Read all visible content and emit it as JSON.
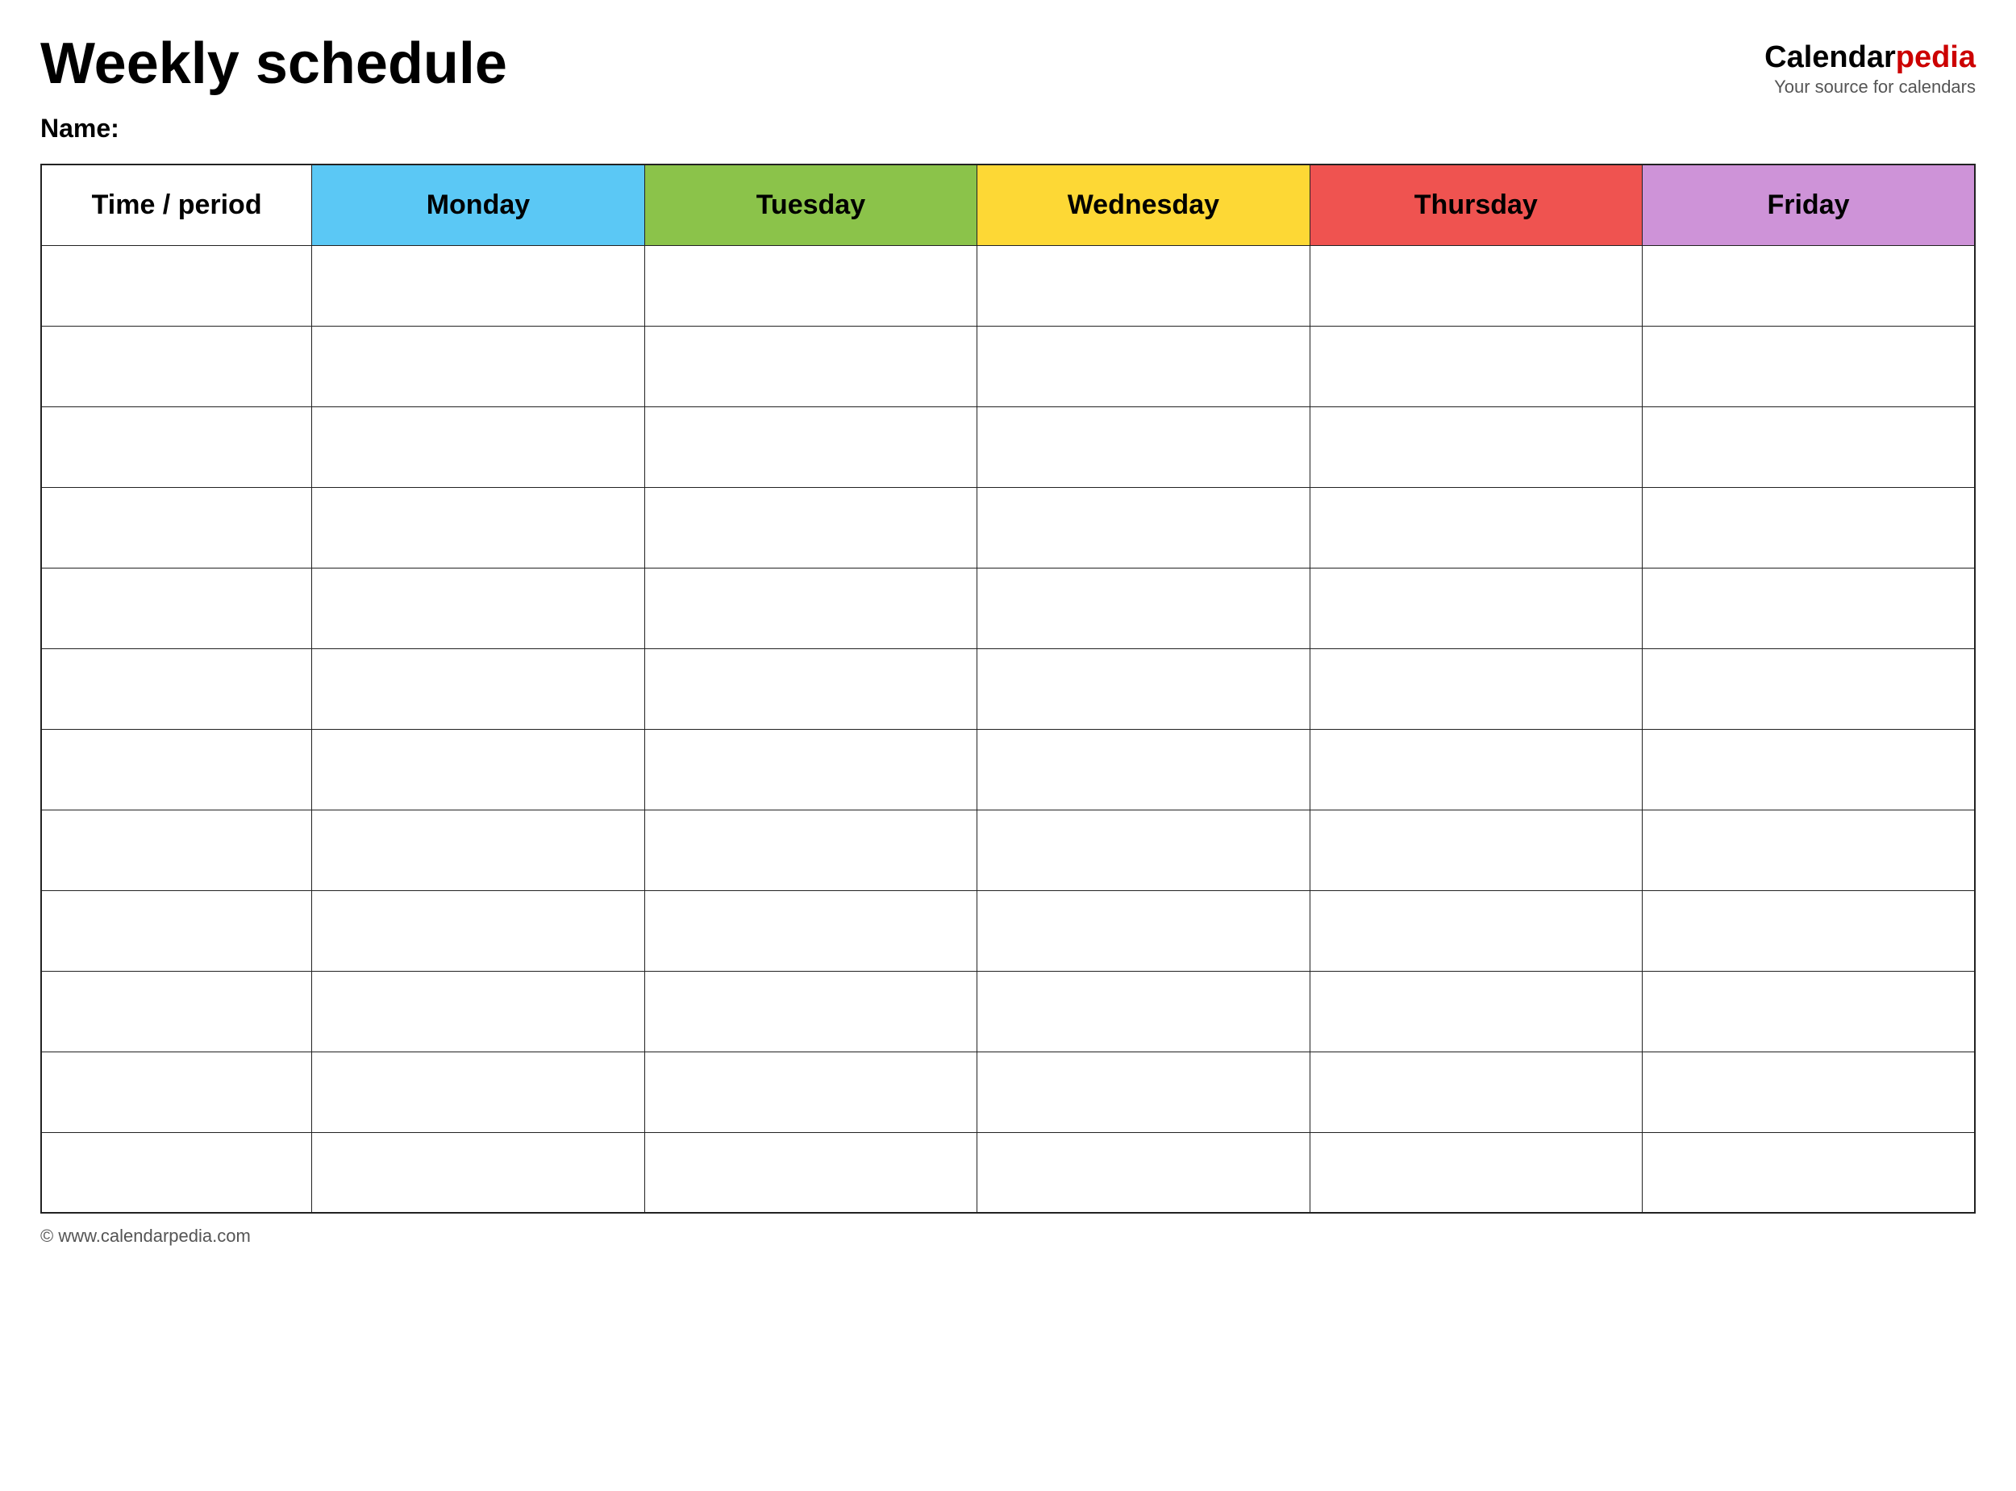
{
  "header": {
    "title": "Weekly schedule",
    "logo": {
      "calendar": "Calendar",
      "pedia": "pedia",
      "subtitle": "Your source for calendars"
    }
  },
  "name_label": "Name:",
  "table": {
    "columns": [
      {
        "id": "time",
        "label": "Time / period",
        "color": "#ffffff"
      },
      {
        "id": "monday",
        "label": "Monday",
        "color": "#5bc8f5"
      },
      {
        "id": "tuesday",
        "label": "Tuesday",
        "color": "#8bc34a"
      },
      {
        "id": "wednesday",
        "label": "Wednesday",
        "color": "#fdd835"
      },
      {
        "id": "thursday",
        "label": "Thursday",
        "color": "#ef5350"
      },
      {
        "id": "friday",
        "label": "Friday",
        "color": "#ce93d8"
      }
    ],
    "rows": 12
  },
  "footer": {
    "copyright": "© www.calendarpedia.com"
  }
}
